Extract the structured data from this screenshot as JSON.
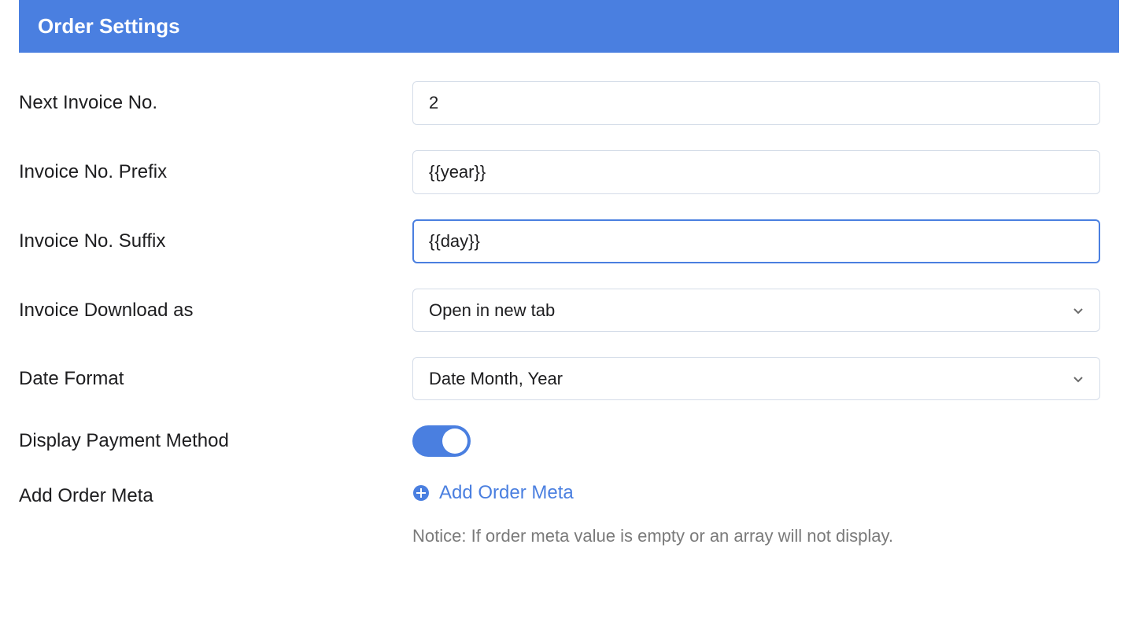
{
  "panel": {
    "title": "Order Settings"
  },
  "fields": {
    "next_invoice_no": {
      "label": "Next Invoice No.",
      "value": "2"
    },
    "invoice_prefix": {
      "label": "Invoice No. Prefix",
      "value": "{{year}}"
    },
    "invoice_suffix": {
      "label": "Invoice No. Suffix",
      "value": "{{day}}"
    },
    "invoice_download": {
      "label": "Invoice Download as",
      "selected": "Open in new tab"
    },
    "date_format": {
      "label": "Date Format",
      "selected": "Date Month, Year"
    },
    "display_payment_method": {
      "label": "Display Payment Method",
      "on": true
    },
    "add_order_meta": {
      "label": "Add Order Meta",
      "button_label": "Add Order Meta"
    }
  },
  "notice": "Notice: If order meta value is empty or an array will not display."
}
